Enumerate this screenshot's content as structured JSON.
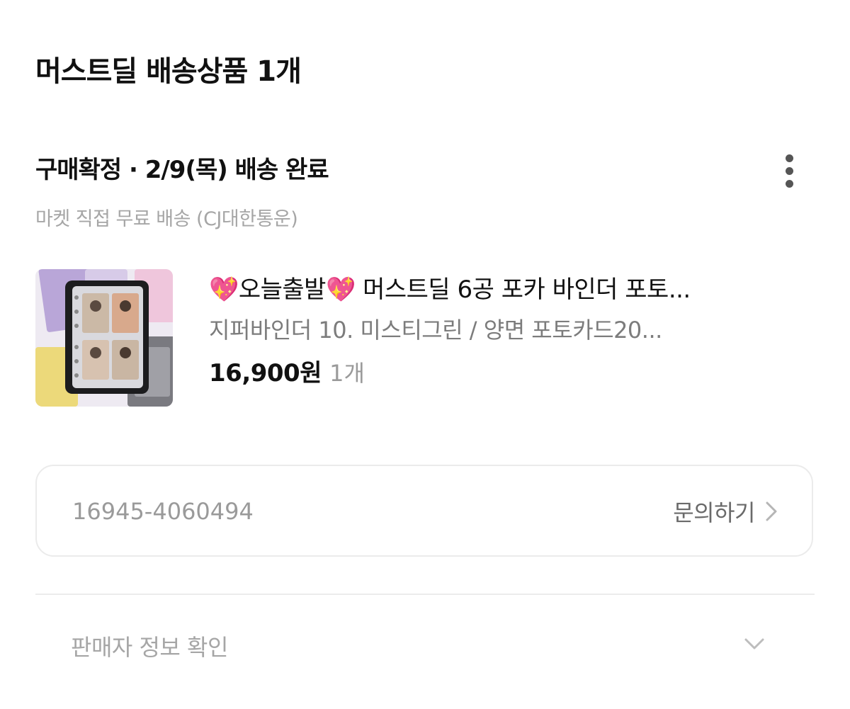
{
  "header": {
    "title": "머스트딜 배송상품 1개"
  },
  "order": {
    "status": "구매확정 · 2/9(목) 배송 완료",
    "shipping_method": "마켓 직접 무료 배송 (CJ대한통운)",
    "more_icon": "more-vertical-icon"
  },
  "product": {
    "name": "💖오늘출발💖 머스트딜 6공 포카 바인더 포토...",
    "option": "지퍼바인더 10. 미스티그린 / 양면 포토카드20...",
    "price": "16,900원",
    "quantity": "1개"
  },
  "order_box": {
    "order_number": "16945-4060494",
    "inquiry_label": "문의하기",
    "arrow_icon": "chevron-right-icon"
  },
  "seller": {
    "label": "판매자 정보 확인",
    "toggle_icon": "chevron-down-icon"
  },
  "colors": {
    "primary_text": "#111111",
    "secondary_text": "#a6a6a6",
    "border": "#ebebeb"
  }
}
